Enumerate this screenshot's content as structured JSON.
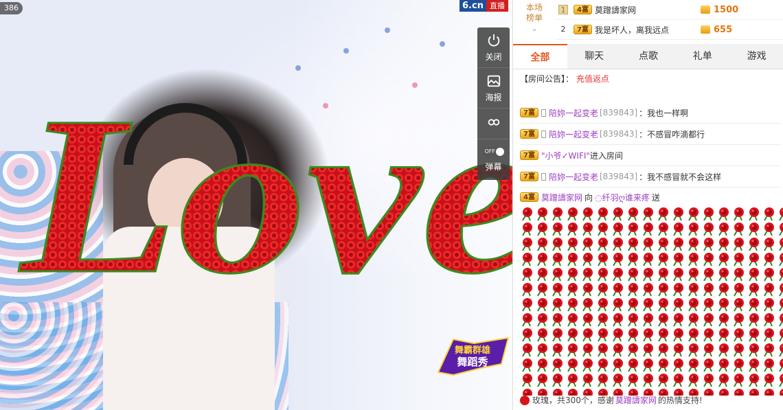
{
  "video": {
    "viewer_badge": "386",
    "brand_domain": "6.cn",
    "brand_live": "直播",
    "overlay_text": "Love",
    "controls": [
      {
        "icon": "power-icon",
        "label": "关闭"
      },
      {
        "icon": "image-icon",
        "label": "海报"
      },
      {
        "icon": "link-icon",
        "label": ""
      },
      {
        "icon": "toggle-icon",
        "label": "弹幕",
        "toggle_text": "OFF"
      }
    ],
    "show_logo": {
      "line1": "舞霸群雄",
      "line2": "舞蹈秀"
    }
  },
  "ranking": {
    "header": [
      "本场",
      "榜单"
    ],
    "rows": [
      {
        "rank": "1",
        "level": "4富",
        "name": "莫蹭譸家网",
        "coins": "1500"
      },
      {
        "rank": "2",
        "level": "7富",
        "name": "我是坏人，离我远点",
        "coins": "655"
      }
    ]
  },
  "tabs": [
    "全部",
    "聊天",
    "点歌",
    "礼单",
    "游戏"
  ],
  "notice": {
    "label": "【房间公告】：",
    "link": "充值返点"
  },
  "messages": [
    {
      "level": "7富",
      "name": "陪妳一起变老",
      "uid": "[839843]",
      "text": "：我也一样啊"
    },
    {
      "level": "7富",
      "name": "陪妳一起变老",
      "uid": "[839843]",
      "text": "：不感冒咋滴都行"
    },
    {
      "level": "7富",
      "name": "\"小爷✓WIFI\"",
      "uid": "",
      "text": "进入房间"
    },
    {
      "level": "7富",
      "name": "陪妳一起变老",
      "uid": "[839843]",
      "text": "：我不感冒就不会这样"
    }
  ],
  "gift": {
    "level": "4富",
    "sender": "莫蹭譸家网",
    "to_word": "向",
    "receiver": "◌纤羽ღ谁来疼",
    "send_word": "送",
    "summary_prefix": "玫瑰，共300个，感谢",
    "summary_name": "莫蹭譸家网",
    "summary_suffix": "的热情支持!"
  },
  "colors": {
    "accent": "#e4561f",
    "rose": "#d8141b",
    "username": "#9b3fc2",
    "coin": "#e2760a"
  }
}
